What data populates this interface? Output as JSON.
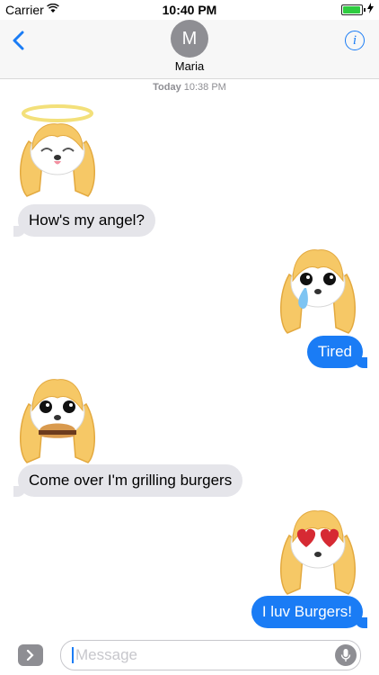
{
  "status_bar": {
    "carrier": "Carrier",
    "time": "10:40 PM",
    "battery_level": 0.95
  },
  "header": {
    "back_icon": "chevron-left-icon",
    "avatar_initial": "M",
    "contact_name": "Maria",
    "info_icon": "info-icon",
    "info_glyph": "i"
  },
  "timestamp": {
    "day": "Today",
    "time": "10:38 PM"
  },
  "messages": [
    {
      "direction": "incoming",
      "sticker": "angel-dog-sticker",
      "text": "How's my angel?"
    },
    {
      "direction": "outgoing",
      "sticker": "crying-dog-sticker",
      "text": "Tired"
    },
    {
      "direction": "incoming",
      "sticker": "burger-dog-sticker",
      "text": "Come over I'm grilling burgers"
    },
    {
      "direction": "outgoing",
      "sticker": "heart-eyes-dog-sticker",
      "text": "I luv Burgers!"
    }
  ],
  "input": {
    "placeholder": "Message",
    "apps_icon": "chevron-right-icon",
    "mic_icon": "microphone-icon"
  },
  "colors": {
    "blue": "#1a7cf5",
    "gray_bubble": "#e5e5ea",
    "fur": "#f6c866",
    "status_green": "#2ecc40"
  }
}
